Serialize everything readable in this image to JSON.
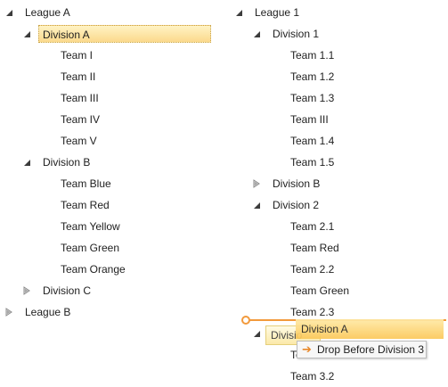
{
  "left_tree": {
    "rows": [
      {
        "label": "League A",
        "expander": "expanded",
        "level": 0
      },
      {
        "label": "Division A",
        "expander": "expanded",
        "level": 1,
        "selected": true
      },
      {
        "label": "Team I",
        "expander": "none",
        "level": 2
      },
      {
        "label": "Team II",
        "expander": "none",
        "level": 2
      },
      {
        "label": "Team III",
        "expander": "none",
        "level": 2
      },
      {
        "label": "Team IV",
        "expander": "none",
        "level": 2
      },
      {
        "label": "Team V",
        "expander": "none",
        "level": 2
      },
      {
        "label": "Division B",
        "expander": "expanded",
        "level": 1
      },
      {
        "label": "Team Blue",
        "expander": "none",
        "level": 2
      },
      {
        "label": "Team Red",
        "expander": "none",
        "level": 2
      },
      {
        "label": "Team Yellow",
        "expander": "none",
        "level": 2
      },
      {
        "label": "Team Green",
        "expander": "none",
        "level": 2
      },
      {
        "label": "Team Orange",
        "expander": "none",
        "level": 2
      },
      {
        "label": "Division C",
        "expander": "collapsed",
        "level": 1
      },
      {
        "label": "League B",
        "expander": "collapsed",
        "level": 0
      }
    ]
  },
  "right_tree": {
    "rows": [
      {
        "label": "League 1",
        "expander": "expanded",
        "level": 0
      },
      {
        "label": "Division 1",
        "expander": "expanded",
        "level": 1
      },
      {
        "label": "Team 1.1",
        "expander": "none",
        "level": 2
      },
      {
        "label": "Team 1.2",
        "expander": "none",
        "level": 2
      },
      {
        "label": "Team 1.3",
        "expander": "none",
        "level": 2
      },
      {
        "label": "Team III",
        "expander": "none",
        "level": 2
      },
      {
        "label": "Team 1.4",
        "expander": "none",
        "level": 2
      },
      {
        "label": "Team 1.5",
        "expander": "none",
        "level": 2
      },
      {
        "label": "Division B",
        "expander": "collapsed",
        "level": 1
      },
      {
        "label": "Division 2",
        "expander": "expanded",
        "level": 1
      },
      {
        "label": "Team 2.1",
        "expander": "none",
        "level": 2
      },
      {
        "label": "Team Red",
        "expander": "none",
        "level": 2
      },
      {
        "label": "Team 2.2",
        "expander": "none",
        "level": 2
      },
      {
        "label": "Team Green",
        "expander": "none",
        "level": 2
      },
      {
        "label": "Team 2.3",
        "expander": "none",
        "level": 2
      },
      {
        "label": "Division 3",
        "display": "Divisio",
        "expander": "expanded",
        "level": 1,
        "drop_target": true
      },
      {
        "label": "Team 3.1",
        "display": "Tea",
        "expander": "none",
        "level": 2
      },
      {
        "label": "Team 3.2",
        "expander": "none",
        "level": 2
      }
    ]
  },
  "drag": {
    "item_label": "Division A",
    "tooltip_arrow": "➔",
    "tooltip_text": "Drop Before Division 3",
    "accent_color": "#f29a3c"
  },
  "icons": {
    "expanded": "triangle-expanded-icon",
    "collapsed": "triangle-collapsed-icon",
    "drop_arrow": "arrow-right-icon"
  }
}
